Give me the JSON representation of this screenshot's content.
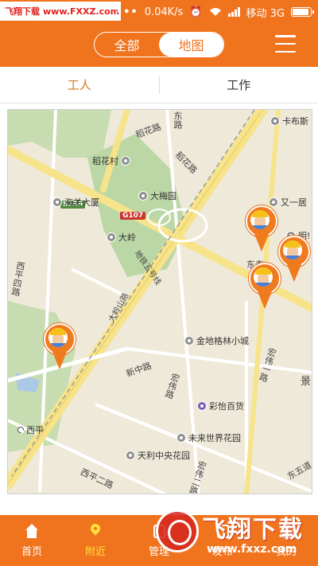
{
  "watermark_top": {
    "site_name": "飞翔下载",
    "url": "www.FXXZ.com"
  },
  "status_bar": {
    "speed": "0.04K/s",
    "carrier": "移动 3G",
    "battery_level": 0.85
  },
  "header": {
    "segments": [
      {
        "label": "全部",
        "active": false
      },
      {
        "label": "地图",
        "active": true
      }
    ]
  },
  "tabs": [
    {
      "label": "工人",
      "active": true
    },
    {
      "label": "工作",
      "active": false
    }
  ],
  "map": {
    "pois": [
      "卡布斯",
      "稻花村",
      "大梅园",
      "海关大厦",
      "又一居",
      "明!",
      "大岭",
      "金地格林小城",
      "彩怡百货",
      "未来世界花园",
      "天利中央花园",
      "西平",
      "东泰",
      "景"
    ],
    "roads": [
      "稻花路",
      "东路",
      "稻花路",
      "S256",
      "G107",
      "地铁五号线",
      "大岭山路",
      "新中路",
      "宏伟路",
      "宏伟一路",
      "东五道",
      "西平二路",
      "西平四路",
      "宏伟二路"
    ],
    "worker_markers": 4
  },
  "bottom_nav": [
    {
      "label": "首页",
      "icon": "home-icon",
      "active": false
    },
    {
      "label": "附近",
      "icon": "location-pin-icon",
      "active": true
    },
    {
      "label": "管理",
      "icon": "manage-icon",
      "active": false
    },
    {
      "label": "发布",
      "icon": "publish-icon",
      "active": false
    },
    {
      "label": "我的",
      "icon": "person-icon",
      "active": false
    }
  ],
  "watermark_bottom": {
    "site_name": "飞翔下载",
    "url": "www.fxxz.com"
  }
}
